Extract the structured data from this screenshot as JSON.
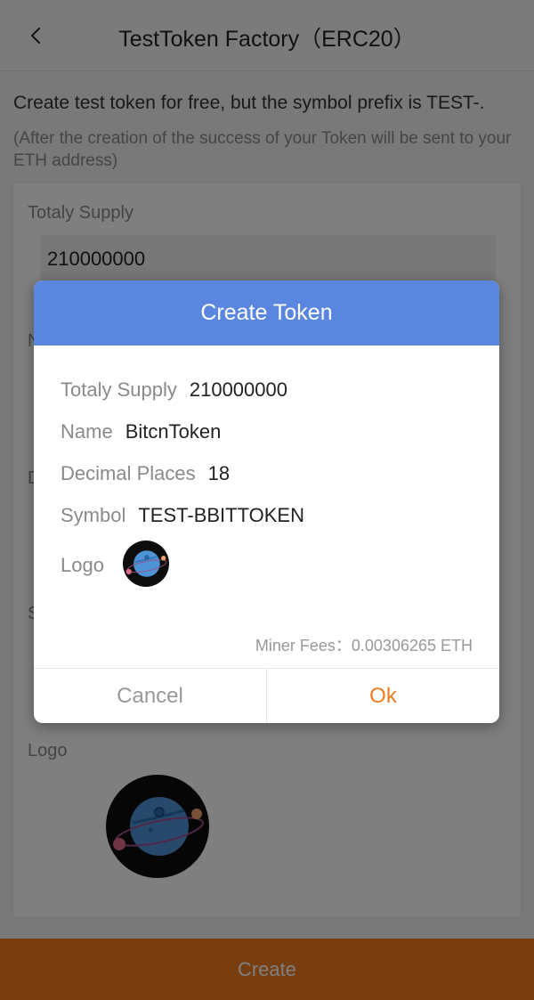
{
  "header": {
    "title": "TestToken Factory（ERC20）"
  },
  "intro": {
    "text": "Create test token for free, but the symbol prefix is TEST-.",
    "note": "(After the creation of the success of your Token will be sent to your ETH address)"
  },
  "form": {
    "supply_label": "Totaly Supply",
    "supply_value": "210000000",
    "logo_label": "Logo",
    "partial_labels": [
      "N",
      "D",
      "S"
    ]
  },
  "create_label": "Create",
  "dialog": {
    "title": "Create Token",
    "rows": [
      {
        "label": "Totaly Supply",
        "value": "210000000"
      },
      {
        "label": "Name",
        "value": "BitcnToken"
      },
      {
        "label": "Decimal Places",
        "value": "18"
      },
      {
        "label": "Symbol",
        "value": "TEST-BBITTOKEN"
      }
    ],
    "logo_label": "Logo",
    "fees": "Miner Fees：0.00306265 ETH",
    "cancel": "Cancel",
    "ok": "Ok"
  },
  "colors": {
    "accent": "#f07c1e",
    "dialog_header": "#5b86e0"
  }
}
